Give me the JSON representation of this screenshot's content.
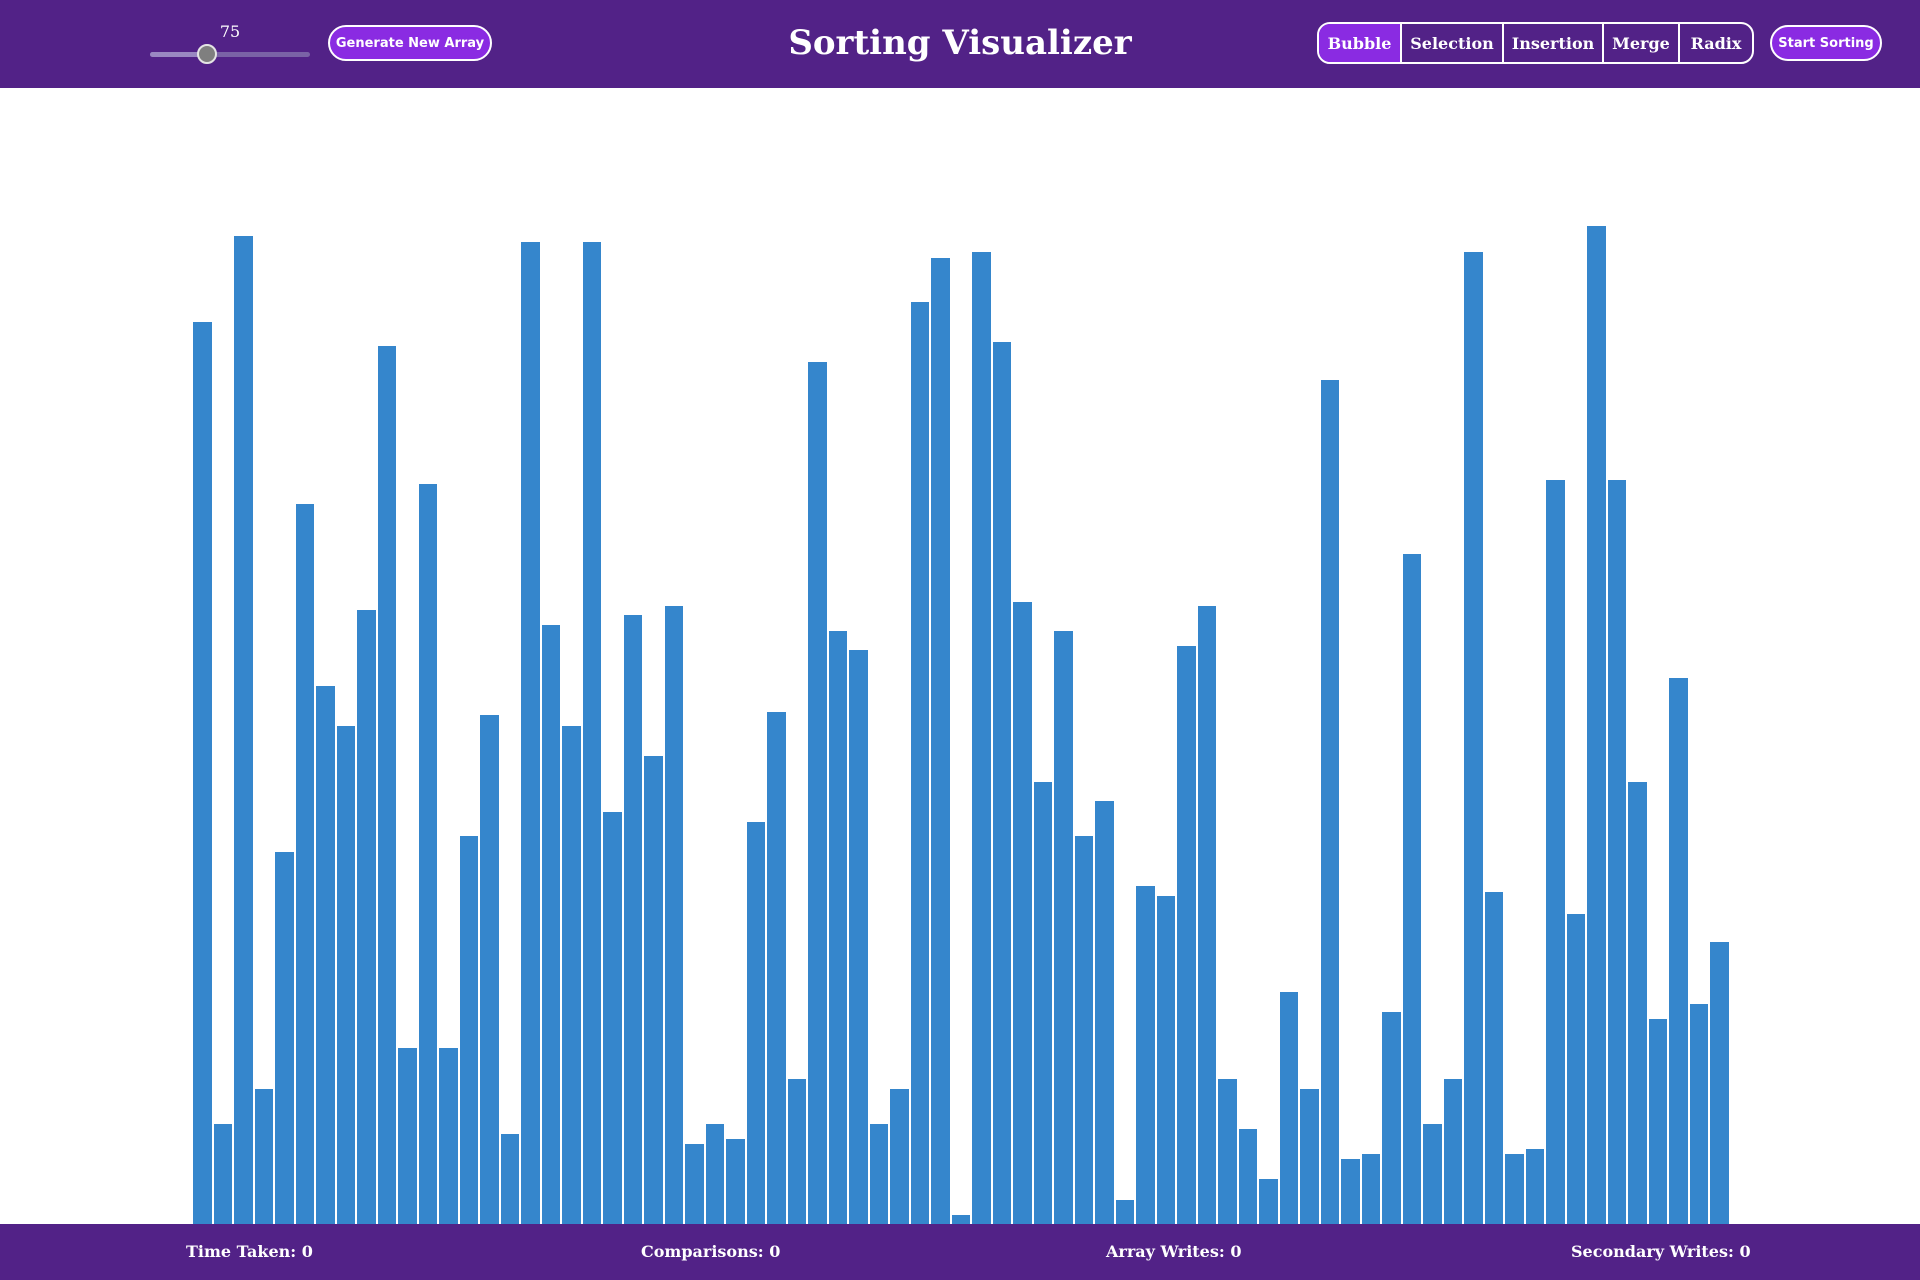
{
  "header": {
    "title": "Sorting Visualizer",
    "array_size": {
      "value": "75",
      "min": 5,
      "max": 200,
      "level": 75
    },
    "generate_label": "Generate New Array",
    "start_label": "Start Sorting",
    "algorithms": [
      {
        "label": "Bubble",
        "selected": true
      },
      {
        "label": "Selection",
        "selected": false
      },
      {
        "label": "Insertion",
        "selected": false
      },
      {
        "label": "Merge",
        "selected": false
      },
      {
        "label": "Radix",
        "selected": false
      }
    ]
  },
  "array": {
    "bar_color": "#3586cc",
    "values": [
      902,
      100,
      988,
      135,
      372,
      720,
      538,
      498,
      614,
      878,
      176,
      740,
      176,
      388,
      509,
      90,
      982,
      599,
      498,
      982,
      412,
      609,
      468,
      618,
      80,
      100,
      85,
      402,
      512,
      145,
      862,
      593,
      574,
      100,
      135,
      922,
      966,
      9,
      972,
      882,
      622,
      442,
      593,
      388,
      423,
      24,
      338,
      328,
      578,
      618,
      145,
      95,
      45,
      232,
      135,
      844,
      65,
      70,
      212,
      670,
      100,
      145,
      972,
      332,
      70,
      75,
      744,
      310,
      998,
      744,
      442,
      205,
      546,
      220,
      282
    ]
  },
  "colors": {
    "header_bg": "#522287",
    "accent": "#8a2be2",
    "text": "#ffffff"
  },
  "footer": {
    "time_taken": "Time Taken: 0",
    "comparisons": "Comparisons: 0",
    "array_writes": "Array Writes: 0",
    "secondary_writes": "Secondary Writes: 0"
  }
}
